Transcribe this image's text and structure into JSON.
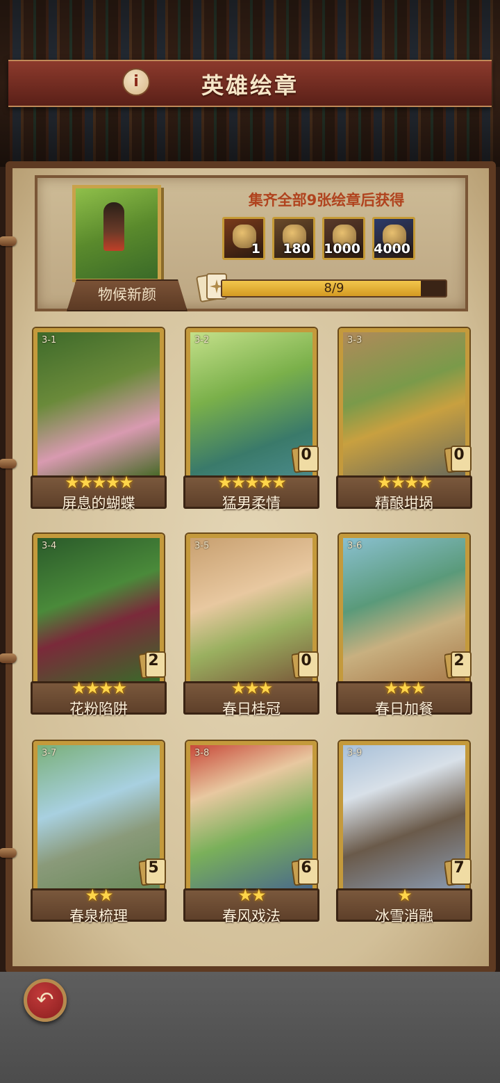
{
  "header": {
    "title": "英雄绘章",
    "info_icon": "i"
  },
  "reward": {
    "title": "集齐全部9张绘章后获得",
    "cover_label": "物候新颜",
    "items": [
      {
        "name": "coin-bag-icon",
        "count": "1",
        "color": "#7a3a1a"
      },
      {
        "name": "scroll-icon",
        "count": "180",
        "color": "#6a4a2a"
      },
      {
        "name": "iron-ore-icon",
        "count": "1000",
        "color": "#5a3a2a"
      },
      {
        "name": "stone-ore-icon",
        "count": "4000",
        "color": "#2a3a6a"
      }
    ],
    "progress_text": "8/9",
    "progress_value": 0.889
  },
  "cards": [
    {
      "id": "3-1",
      "name": "屏息的蝴蝶",
      "stars": "★★★★★",
      "dup": "",
      "art": "linear-gradient(160deg,#3e6a2a,#6a8a3a 40%,#d89ab0 70%,#4a6a2a)"
    },
    {
      "id": "3-2",
      "name": "猛男柔情",
      "stars": "★★★★★",
      "dup": "0",
      "art": "linear-gradient(160deg,#c4e08a,#7ab04a 40%,#3a7a6a 75%,#4a8a8a)"
    },
    {
      "id": "3-3",
      "name": "精酿坩埚",
      "stars": "★★★★",
      "dup": "0",
      "art": "linear-gradient(160deg,#b08a5a,#7a9a4a 40%,#c8a040 60%,#6a6a5a)"
    },
    {
      "id": "3-4",
      "name": "花粉陷阱",
      "stars": "★★★★",
      "dup": "2",
      "art": "linear-gradient(160deg,#2a5a2a,#4a8a3a 40%,#7a2a3a 60%,#3a6a2a)"
    },
    {
      "id": "3-5",
      "name": "春日桂冠",
      "stars": "★★★",
      "dup": "0",
      "art": "linear-gradient(160deg,#c8a070,#e8c8a0 40%,#9ab060 65%,#7a5a3a)"
    },
    {
      "id": "3-6",
      "name": "春日加餐",
      "stars": "★★★",
      "dup": "2",
      "art": "linear-gradient(160deg,#8ac0d0,#5a9a7a 40%,#c8b080 65%,#a87a4a)"
    },
    {
      "id": "3-7",
      "name": "春泉梳理",
      "stars": "★★",
      "dup": "5",
      "art": "linear-gradient(160deg,#7ab07a,#a8d0e0 40%,#8a9a7a 65%,#6a8a5a)"
    },
    {
      "id": "3-8",
      "name": "春风戏法",
      "stars": "★★",
      "dup": "6",
      "art": "linear-gradient(160deg,#c84a3a,#e8c8a0 30%,#7ab05a 60%,#4a6a8a)"
    },
    {
      "id": "3-9",
      "name": "冰雪消融",
      "stars": "★",
      "dup": "7",
      "art": "linear-gradient(160deg,#a8c0d8,#d8e0e8 30%,#6a5a4a 60%,#8a9ab0)"
    }
  ],
  "nav": {
    "back_icon": "↶"
  }
}
